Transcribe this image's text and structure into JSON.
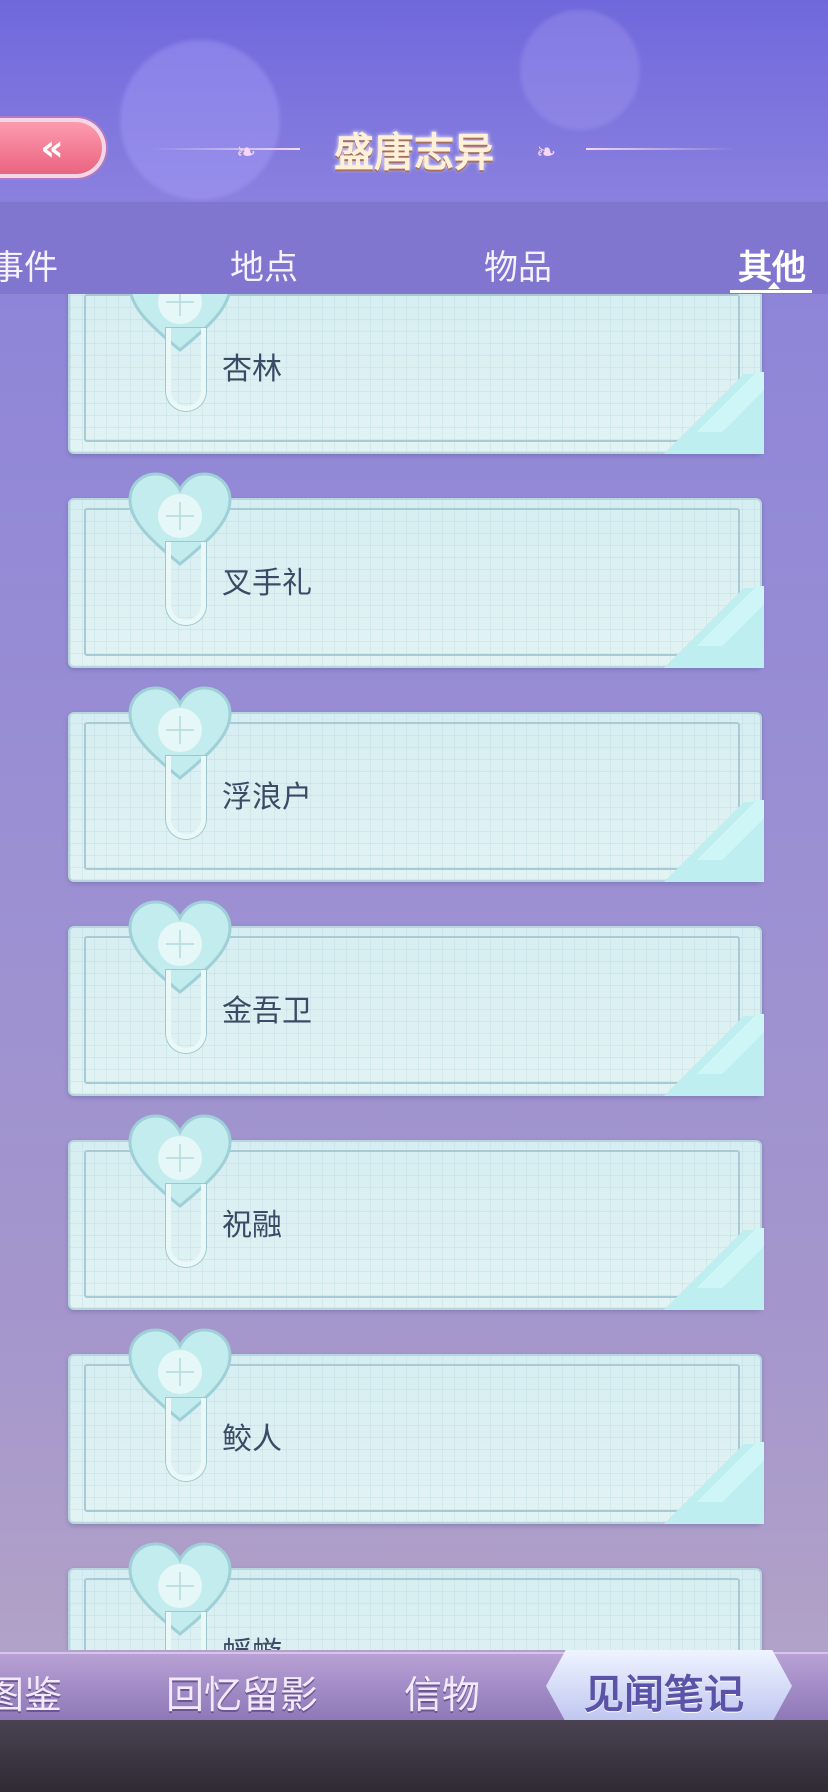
{
  "header": {
    "back_label": "«",
    "title": "盛唐志异"
  },
  "tabs": [
    {
      "label": "事件",
      "active": false
    },
    {
      "label": "地点",
      "active": false
    },
    {
      "label": "物品",
      "active": false
    },
    {
      "label": "其他",
      "active": true
    }
  ],
  "entries": [
    {
      "label": "杏林"
    },
    {
      "label": "叉手礼"
    },
    {
      "label": "浮浪户"
    },
    {
      "label": "金吾卫"
    },
    {
      "label": "祝融"
    },
    {
      "label": "鲛人"
    },
    {
      "label": "蜉蝣"
    }
  ],
  "bottom_nav": {
    "items": [
      "图鉴",
      "回忆留影",
      "信物"
    ],
    "active": "见闻笔记"
  },
  "colors": {
    "accent": "#5a53a8",
    "card": "#d6eef2",
    "back_button": "#e8607d"
  }
}
